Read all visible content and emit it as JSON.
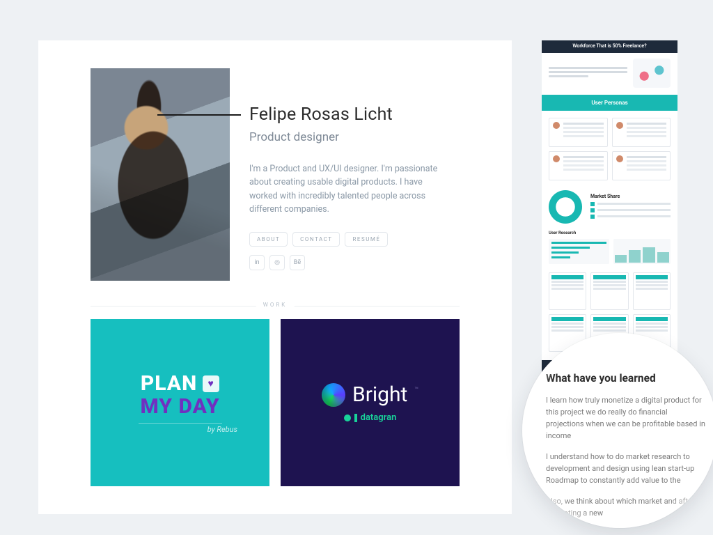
{
  "profile": {
    "name": "Felipe Rosas Licht",
    "role": "Product designer",
    "bio": "I'm a Product and UX/UI designer. I'm passionate about creating usable digital products. I have worked with incredibly talented people across different companies.",
    "links": {
      "about": "ABOUT",
      "contact": "CONTACT",
      "resume": "RESUMÉ"
    },
    "socials": {
      "linkedin": "in",
      "pinterest": "◎",
      "behance": "Bē"
    }
  },
  "section_label": "WORK",
  "tiles": {
    "plan": {
      "line1": "PLAN",
      "line2": "MY DAY",
      "by": "by Rebus",
      "icon": "♥"
    },
    "bright": {
      "name": "Bright",
      "tm": "™",
      "sub": "datagran"
    }
  },
  "side_preview": {
    "top_banner": "Workforce That is 50% Freelance?",
    "section": "User Personas",
    "market_share_label": "Market Share",
    "user_research_label": "User Research"
  },
  "lens": {
    "heading": "What have you learned",
    "p1": "I learn how truly monetize a digital product for this project we do really do financial projections when we can be profitable based in income",
    "p2": "I understand how to do market research to development and design using lean start-up Roadmap to constantly add value to the",
    "p3": "Also, we think about which market and after promoting a new"
  }
}
